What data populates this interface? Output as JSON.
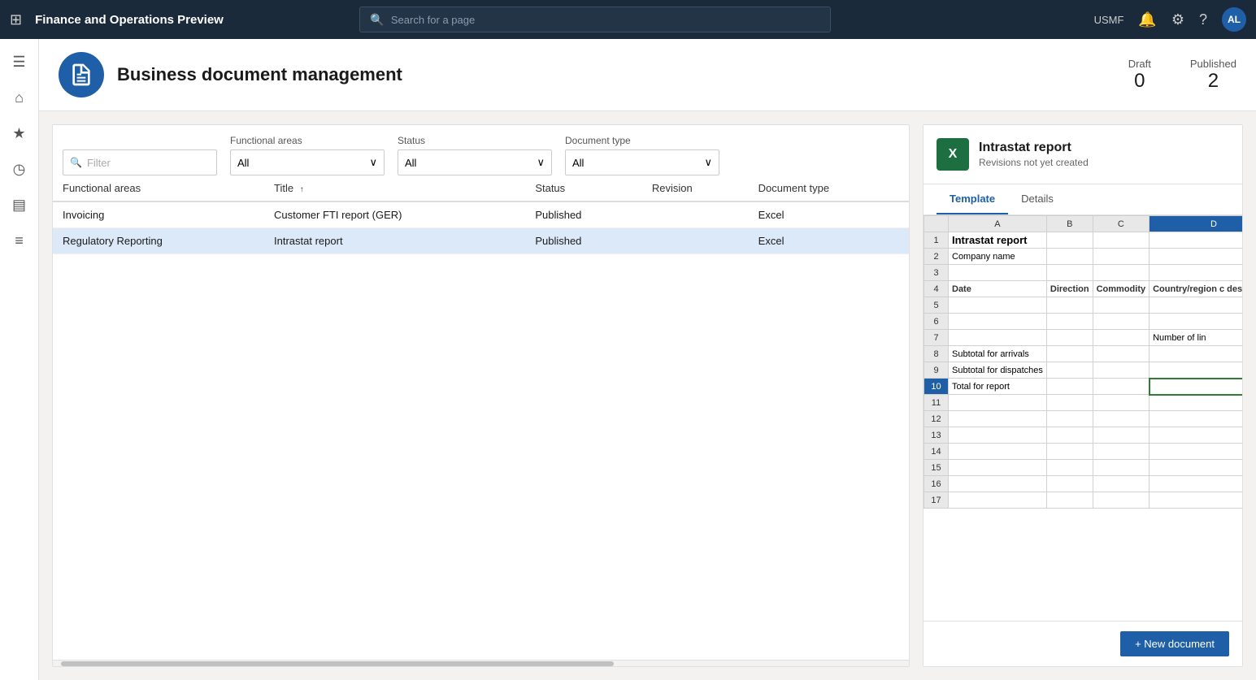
{
  "app": {
    "title": "Finance and Operations Preview",
    "company": "USMF"
  },
  "topbar": {
    "search_placeholder": "Search for a page",
    "icons": {
      "grid": "⊞",
      "bell": "🔔",
      "gear": "⚙",
      "help": "?",
      "avatar": "AL"
    }
  },
  "sidebar": {
    "icons": [
      "☰",
      "⌂",
      "★",
      "◷",
      "▤",
      "≡"
    ]
  },
  "page": {
    "title": "Business document management",
    "stats": {
      "draft_label": "Draft",
      "draft_value": "0",
      "published_label": "Published",
      "published_value": "2"
    }
  },
  "filters": {
    "filter_placeholder": "Filter",
    "functional_areas_label": "Functional areas",
    "functional_areas_value": "All",
    "status_label": "Status",
    "status_value": "All",
    "document_type_label": "Document type",
    "document_type_value": "All"
  },
  "table": {
    "columns": [
      {
        "key": "functional_areas",
        "label": "Functional areas",
        "sortable": false
      },
      {
        "key": "title",
        "label": "Title",
        "sortable": true
      },
      {
        "key": "status",
        "label": "Status",
        "sortable": false
      },
      {
        "key": "revision",
        "label": "Revision",
        "sortable": false
      },
      {
        "key": "document_type",
        "label": "Document type",
        "sortable": false
      }
    ],
    "rows": [
      {
        "functional_areas": "Invoicing",
        "title": "Customer FTI report (GER)",
        "status": "Published",
        "revision": "",
        "document_type": "Excel",
        "selected": false
      },
      {
        "functional_areas": "Regulatory Reporting",
        "title": "Intrastat report",
        "status": "Published",
        "revision": "",
        "document_type": "Excel",
        "selected": true
      }
    ]
  },
  "detail": {
    "title": "Intrastat report",
    "subtitle": "Revisions not yet created",
    "tabs": [
      {
        "label": "Template",
        "active": true
      },
      {
        "label": "Details",
        "active": false
      }
    ],
    "excel": {
      "col_headers": [
        "",
        "A",
        "B",
        "C",
        "D"
      ],
      "rows": [
        {
          "num": "1",
          "cells": [
            "Intrastat report",
            "",
            "",
            ""
          ]
        },
        {
          "num": "2",
          "cells": [
            "Company name",
            "",
            "",
            ""
          ]
        },
        {
          "num": "3",
          "cells": [
            "",
            "",
            "",
            ""
          ]
        },
        {
          "num": "4",
          "cells": [
            "Date",
            "Direction",
            "Commodity",
            "Country/region c destination"
          ]
        },
        {
          "num": "5",
          "cells": [
            "",
            "",
            "",
            ""
          ]
        },
        {
          "num": "6",
          "cells": [
            "",
            "",
            "",
            ""
          ]
        },
        {
          "num": "7",
          "cells": [
            "",
            "",
            "",
            "Number of lin"
          ]
        },
        {
          "num": "8",
          "cells": [
            "Subtotal for arrivals",
            "",
            "",
            ""
          ]
        },
        {
          "num": "9",
          "cells": [
            "Subtotal for dispatches",
            "",
            "",
            ""
          ]
        },
        {
          "num": "10",
          "cells": [
            "Total for report",
            "",
            "",
            ""
          ],
          "highlight": true
        },
        {
          "num": "11",
          "cells": [
            "",
            "",
            "",
            ""
          ]
        },
        {
          "num": "12",
          "cells": [
            "",
            "",
            "",
            ""
          ]
        },
        {
          "num": "13",
          "cells": [
            "",
            "",
            "",
            ""
          ]
        },
        {
          "num": "14",
          "cells": [
            "",
            "",
            "",
            ""
          ]
        },
        {
          "num": "15",
          "cells": [
            "",
            "",
            "",
            ""
          ]
        },
        {
          "num": "16",
          "cells": [
            "",
            "",
            "",
            ""
          ]
        },
        {
          "num": "17",
          "cells": [
            "",
            "",
            "",
            ""
          ]
        }
      ]
    },
    "new_doc_button": "+ New document"
  }
}
